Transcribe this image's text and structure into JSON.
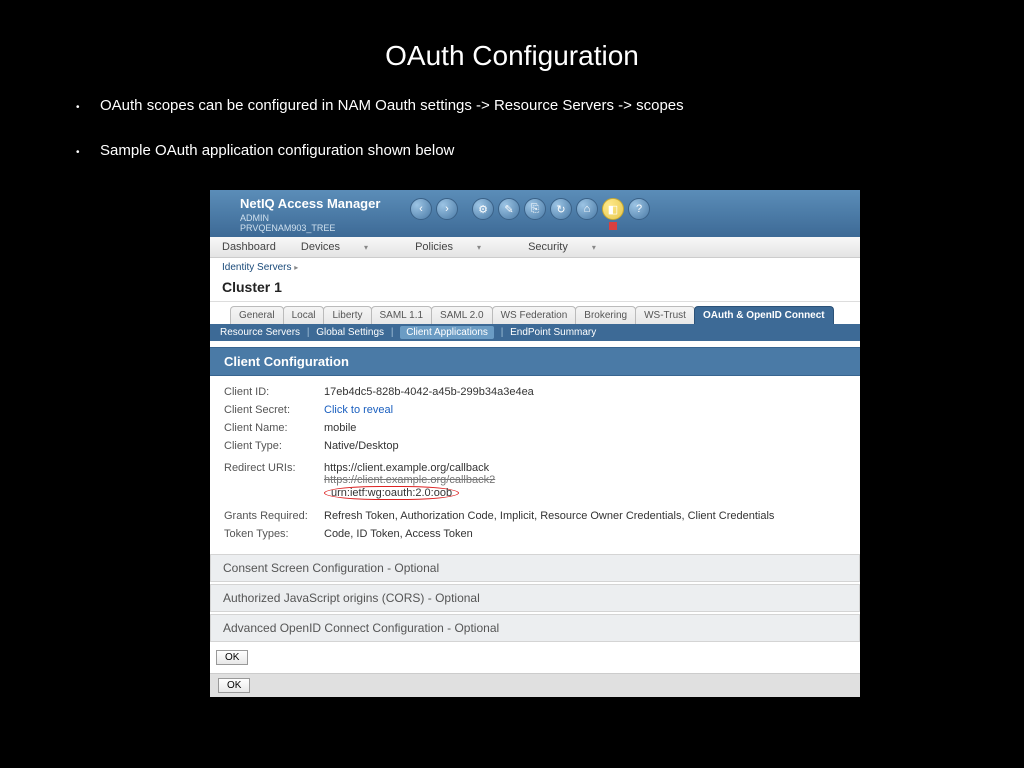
{
  "title": "OAuth Configuration",
  "bullets": [
    "OAuth scopes can be configured in NAM Oauth settings -> Resource Servers -> scopes",
    "Sample OAuth application configuration shown below"
  ],
  "header": {
    "brand": "NetIQ Access Manager",
    "admin": "ADMIN",
    "tree": "PRVQENAM903_TREE"
  },
  "menubar": [
    "Dashboard",
    "Devices",
    "Policies",
    "Security"
  ],
  "breadcrumb": "Identity Servers",
  "cluster": "Cluster 1",
  "tabs": [
    "General",
    "Local",
    "Liberty",
    "SAML 1.1",
    "SAML 2.0",
    "WS Federation",
    "Brokering",
    "WS-Trust",
    "OAuth & OpenID Connect"
  ],
  "active_tab": "OAuth & OpenID Connect",
  "subtabs": {
    "items": [
      "Resource Servers",
      "Global Settings",
      "Client Applications",
      "EndPoint Summary"
    ],
    "active": "Client Applications"
  },
  "panel_title": "Client Configuration",
  "fields": {
    "client_id": {
      "label": "Client ID:",
      "value": "17eb4dc5-828b-4042-a45b-299b34a3e4ea"
    },
    "client_secret": {
      "label": "Client Secret:",
      "value": "Click to reveal"
    },
    "client_name": {
      "label": "Client Name:",
      "value": "mobile"
    },
    "client_type": {
      "label": "Client Type:",
      "value": "Native/Desktop"
    },
    "redirect_label": "Redirect URIs:",
    "redirect_uris": [
      "https://client.example.org/callback",
      "https://client.example.org/callback2",
      "urn:ietf:wg:oauth:2.0:oob"
    ],
    "grants": {
      "label": "Grants Required:",
      "value": "Refresh Token, Authorization Code, Implicit, Resource Owner Credentials, Client Credentials"
    },
    "tokens": {
      "label": "Token Types:",
      "value": "Code, ID Token, Access Token"
    }
  },
  "accordions": [
    "Consent Screen Configuration - Optional",
    "Authorized JavaScript origins (CORS) - Optional",
    "Advanced OpenID Connect Configuration - Optional"
  ],
  "ok": "OK"
}
